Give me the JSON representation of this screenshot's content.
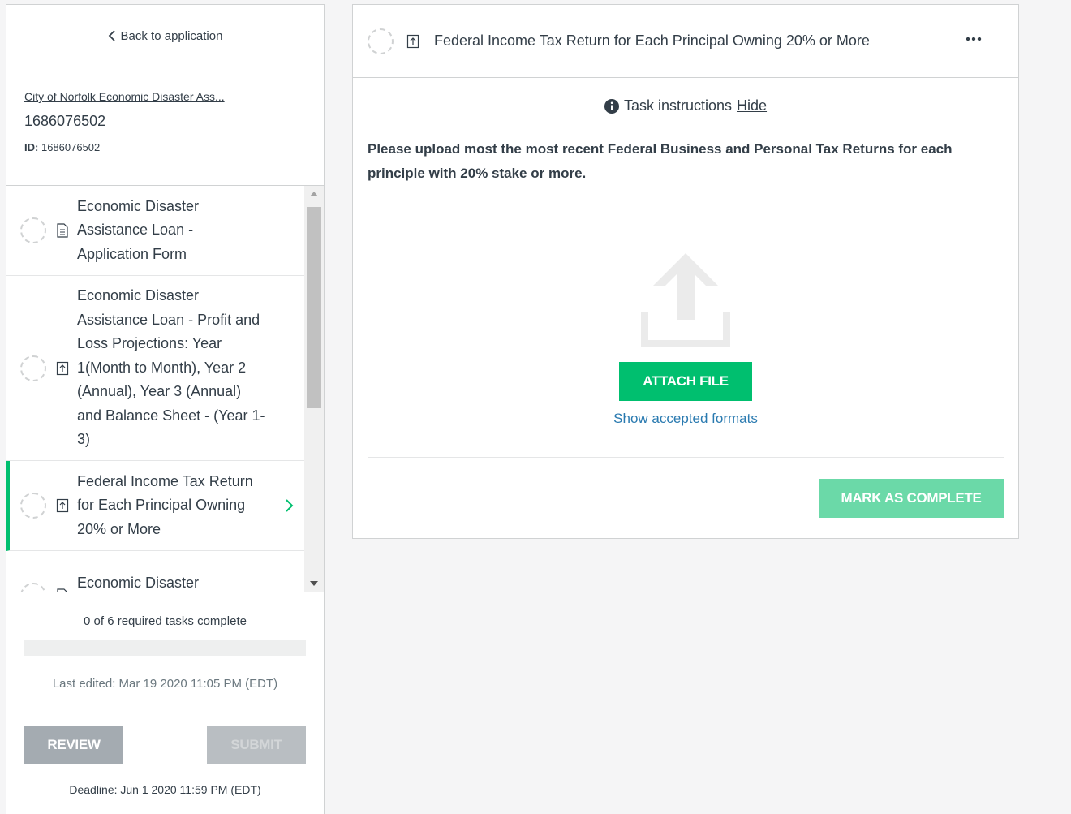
{
  "sidebar": {
    "back_label": "Back to application",
    "app_name": "City of Norfolk Economic Disaster Ass...",
    "app_number": "1686076502",
    "app_id_label": "ID:",
    "app_id_value": "1686076502",
    "tasks": [
      {
        "label": "Economic Disaster Assistance Loan - Application Form",
        "type": "form-icon"
      },
      {
        "label": "Economic Disaster Assistance Loan - Profit and Loss Projections: Year 1(Month to Month), Year 2 (Annual), Year 3 (Annual) and Balance Sheet - (Year 1-3)",
        "type": "upload-icon"
      },
      {
        "label": "Federal Income Tax Return for Each Principal Owning 20% or More",
        "type": "upload-icon"
      },
      {
        "label": "Economic Disaster Assistance Loan - Bank",
        "type": "form-icon"
      }
    ],
    "progress_text": "0 of 6 required tasks complete",
    "progress_fraction": 0,
    "last_edited": "Last edited: Mar 19 2020 11:05 PM (EDT)",
    "review_label": "REVIEW",
    "submit_label": "SUBMIT",
    "deadline": "Deadline: Jun 1 2020 11:59 PM (EDT)"
  },
  "panel": {
    "title": "Federal Income Tax Return for Each Principal Owning 20% or More",
    "instructions_label": "Task instructions",
    "hide_label": "Hide",
    "instructions_text": "Please upload most the most recent Federal Business and Personal Tax Returns for each principle with 20% stake or more.",
    "attach_label": "ATTACH FILE",
    "formats_label": "Show accepted formats",
    "complete_label": "MARK AS COMPLETE"
  },
  "colors": {
    "accent": "#00bf6f",
    "accent_disabled": "#6bd9a8",
    "link": "#2a7ab0",
    "text": "#333e48"
  }
}
